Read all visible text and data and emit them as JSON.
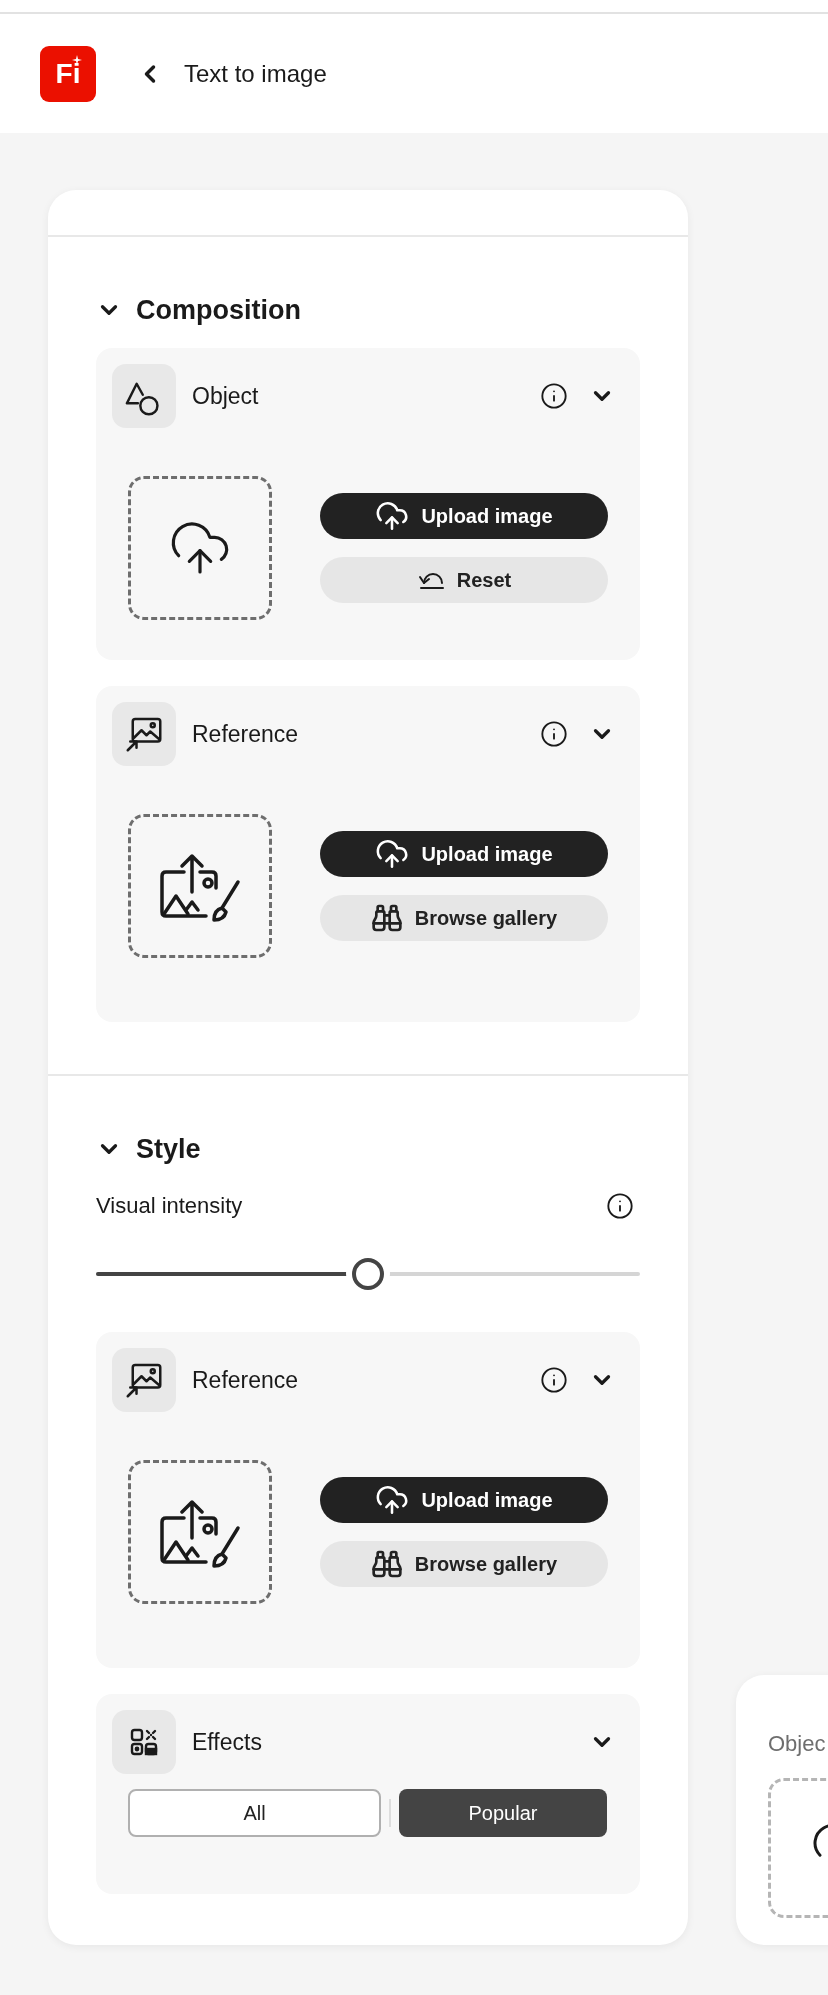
{
  "header": {
    "logo": "Fi",
    "title": "Text to image"
  },
  "sections": [
    {
      "title": "Composition",
      "expanded": true,
      "cards": [
        {
          "kind": "object",
          "title": "Object",
          "expanded": true,
          "buttons": [
            {
              "kind": "upload",
              "label": "Upload image"
            },
            {
              "kind": "reset",
              "label": "Reset"
            }
          ]
        },
        {
          "kind": "reference",
          "title": "Reference",
          "expanded": true,
          "buttons": [
            {
              "kind": "upload",
              "label": "Upload image"
            },
            {
              "kind": "browse",
              "label": "Browse gallery"
            }
          ]
        }
      ]
    },
    {
      "title": "Style",
      "expanded": true,
      "slider": {
        "label": "Visual intensity",
        "level": 0.5
      },
      "cards": [
        {
          "kind": "reference",
          "title": "Reference",
          "expanded": true,
          "buttons": [
            {
              "kind": "upload",
              "label": "Upload image"
            },
            {
              "kind": "browse",
              "label": "Browse gallery"
            }
          ]
        },
        {
          "kind": "effects",
          "title": "Effects",
          "expanded": true,
          "tabs": [
            {
              "label": "All",
              "selected": false
            },
            {
              "label": "Popular",
              "selected": true
            }
          ]
        }
      ]
    }
  ],
  "side_card": {
    "label": "Objec"
  }
}
